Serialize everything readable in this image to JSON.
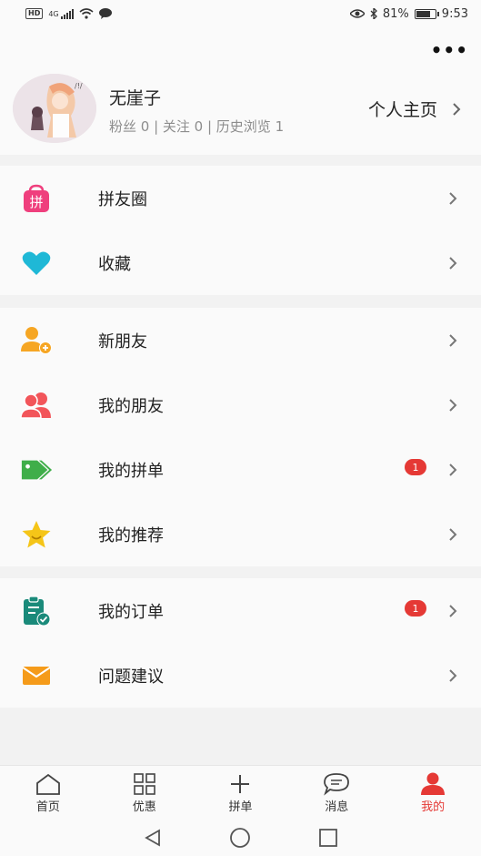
{
  "status_bar": {
    "hd": "HD",
    "network": "4G",
    "battery_pct_text": "81%",
    "battery_level": 0.81,
    "time": "9:53"
  },
  "profile": {
    "name": "无崖子",
    "stats": "粉丝 0 | 关注 0 | 历史浏览 1",
    "homepage_label": "个人主页"
  },
  "menu_groups": [
    [
      {
        "label": "拼友圈",
        "icon": "pin-bag-icon",
        "color": "#ef3f7d",
        "glyph": "拼"
      },
      {
        "label": "收藏",
        "icon": "heart-icon",
        "color": "#1fb8d6"
      }
    ],
    [
      {
        "label": "新朋友",
        "icon": "add-friend-icon",
        "color": "#f6a623"
      },
      {
        "label": "我的朋友",
        "icon": "friends-icon",
        "color": "#f2555a"
      },
      {
        "label": "我的拼单",
        "icon": "tag-icon",
        "color": "#3fae49",
        "badge": "1"
      },
      {
        "label": "我的推荐",
        "icon": "star-icon",
        "color": "#f5c518"
      }
    ],
    [
      {
        "label": "我的订单",
        "icon": "order-clipboard-icon",
        "color": "#1a8a7a",
        "badge": "1"
      },
      {
        "label": "问题建议",
        "icon": "mail-icon",
        "color": "#f59b1a"
      }
    ]
  ],
  "tabs": [
    {
      "label": "首页",
      "icon": "home-icon"
    },
    {
      "label": "优惠",
      "icon": "grid-icon"
    },
    {
      "label": "拼单",
      "icon": "plus-icon"
    },
    {
      "label": "消息",
      "icon": "chat-icon"
    },
    {
      "label": "我的",
      "icon": "person-icon",
      "active": true
    }
  ],
  "colors": {
    "accent": "#e53935",
    "background": "#f2f2f2"
  }
}
